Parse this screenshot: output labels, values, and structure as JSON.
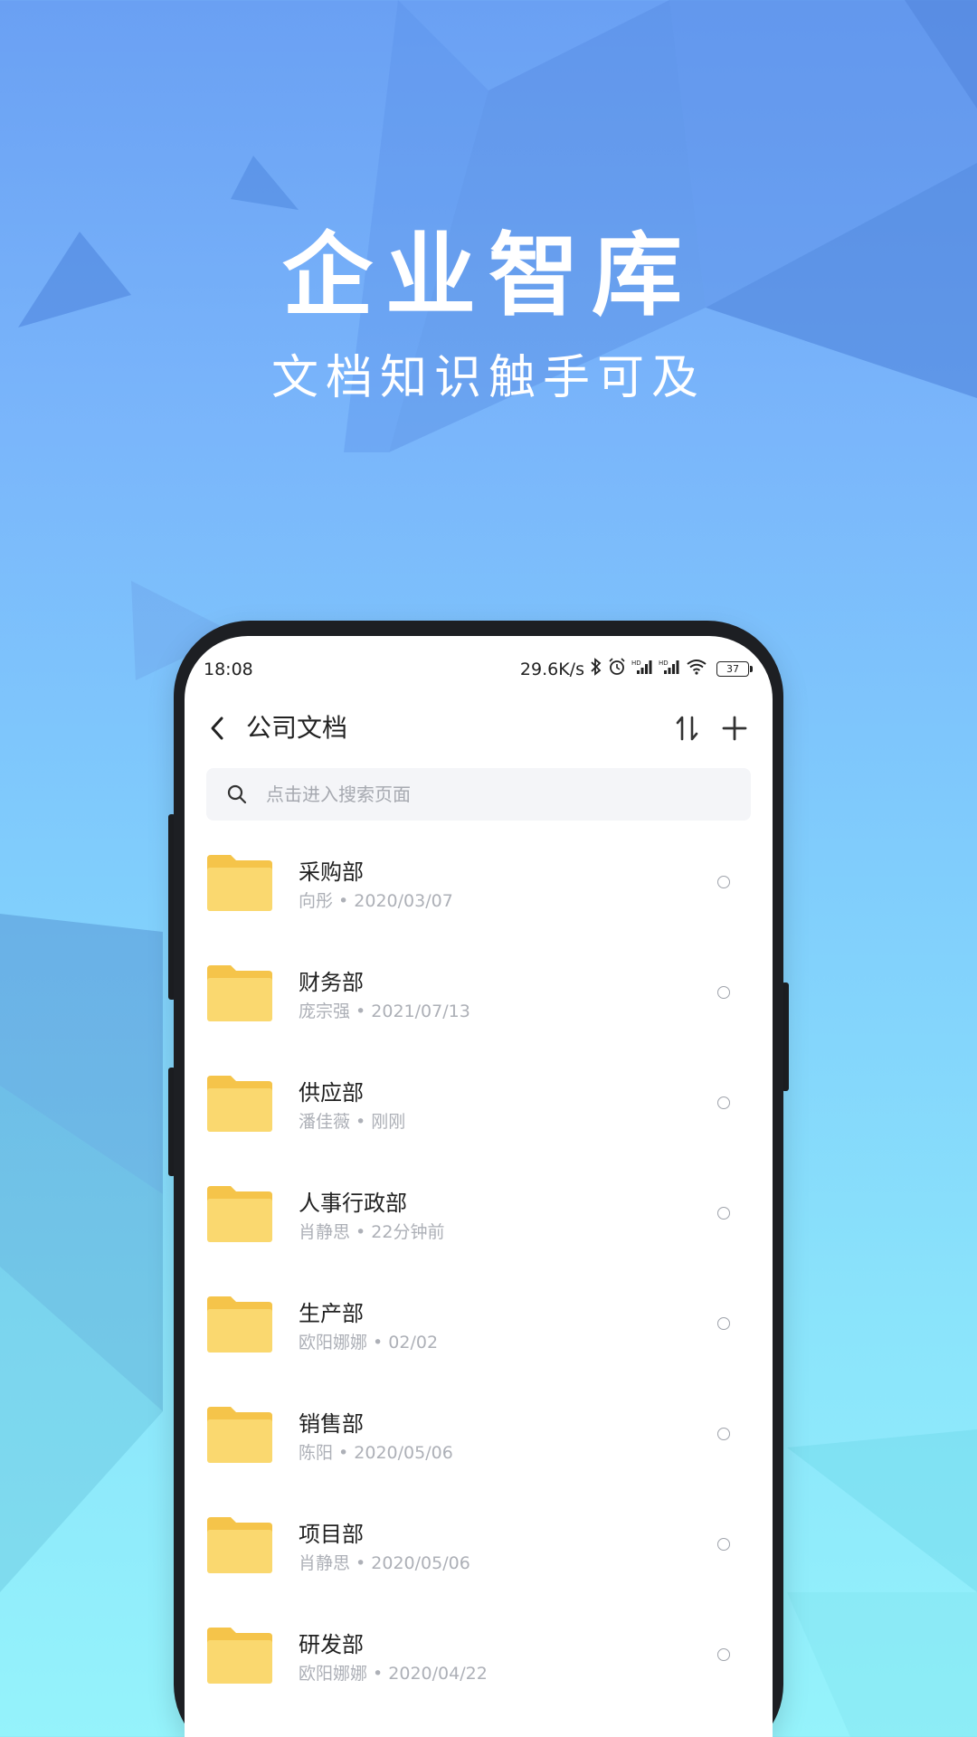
{
  "hero": {
    "title": "企业智库",
    "subtitle": "文档知识触手可及"
  },
  "status_bar": {
    "time": "18:08",
    "network_speed": "29.6K/s",
    "icons": [
      "bluetooth-icon",
      "alarm-icon",
      "signal-hd-icon",
      "signal-hd-icon",
      "wifi-icon"
    ],
    "battery": "37"
  },
  "header": {
    "title": "公司文档",
    "back_icon": "chevron-left-icon",
    "sort_icon": "sort-icon",
    "add_icon": "plus-icon"
  },
  "search": {
    "placeholder": "点击进入搜索页面",
    "value": ""
  },
  "colors": {
    "folder_back": "#f5c44a",
    "folder_front": "#fad86f",
    "meta_text": "#adb0b7",
    "search_bg": "#f4f5f8"
  },
  "files": [
    {
      "name": "采购部",
      "meta": "向彤 • 2020/03/07"
    },
    {
      "name": "财务部",
      "meta": "庞宗强 • 2021/07/13"
    },
    {
      "name": "供应部",
      "meta": "潘佳薇 • 刚刚"
    },
    {
      "name": "人事行政部",
      "meta": "肖静思 • 22分钟前"
    },
    {
      "name": "生产部",
      "meta": "欧阳娜娜 • 02/02"
    },
    {
      "name": "销售部",
      "meta": "陈阳 • 2020/05/06"
    },
    {
      "name": "项目部",
      "meta": "肖静思 • 2020/05/06"
    },
    {
      "name": "研发部",
      "meta": "欧阳娜娜 • 2020/04/22"
    }
  ]
}
